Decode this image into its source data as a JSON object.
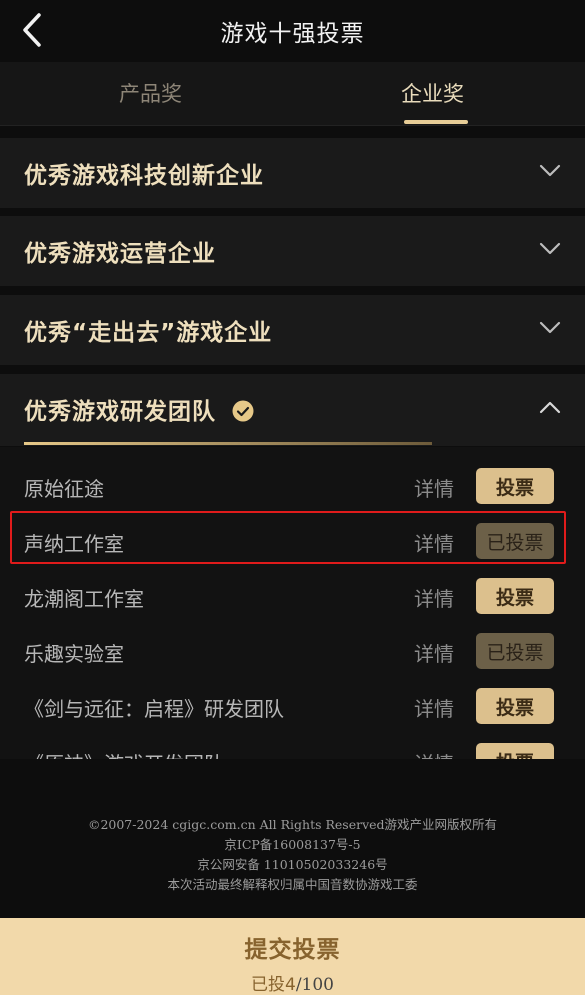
{
  "header": {
    "title": "游戏十强投票"
  },
  "tabs": [
    {
      "label": "产品奖",
      "active": false
    },
    {
      "label": "企业奖",
      "active": true
    }
  ],
  "sections": [
    {
      "title": "优秀游戏科技创新企业",
      "expanded": false
    },
    {
      "title": "优秀游戏运营企业",
      "expanded": false
    },
    {
      "title": "优秀“走出去”游戏企业",
      "expanded": false
    },
    {
      "title": "优秀游戏研发团队",
      "expanded": true,
      "completed": true
    }
  ],
  "list": [
    {
      "name": "原始征途",
      "detail": "详情",
      "vote": "投票",
      "voted": false
    },
    {
      "name": "声纳工作室",
      "detail": "详情",
      "vote": "已投票",
      "voted": true
    },
    {
      "name": "龙潮阁工作室",
      "detail": "详情",
      "vote": "投票",
      "voted": false
    },
    {
      "name": "乐趣实验室",
      "detail": "详情",
      "vote": "已投票",
      "voted": true
    },
    {
      "name": "《剑与远征：启程》研发团队",
      "detail": "详情",
      "vote": "投票",
      "voted": false
    },
    {
      "name": "《原神》游戏开发团队",
      "detail": "详情",
      "vote": "投票",
      "voted": false
    }
  ],
  "footer": {
    "line1": "©2007-2024 cgigc.com.cn All Rights Reserved游戏产业网版权所有",
    "line2": "京ICP备16008137号-5",
    "line3": "京公网安备 11010502033246号",
    "line4": "本次活动最终解释权归属中国音数协游戏工委"
  },
  "submit": {
    "label": "提交投票",
    "count_prefix": "已投",
    "count": "4",
    "total": "/100"
  },
  "colors": {
    "accent_gold": "#e7cd97",
    "vote_button": "#dcc08d",
    "voted_button": "#6c6048",
    "highlight_red": "#e01b1b",
    "submit_bar": "#f2d9aa"
  },
  "icons": {
    "back": "chevron-left-icon",
    "collapsed": "chevron-down-icon",
    "expanded": "chevron-up-icon",
    "completed": "check-circle-icon"
  }
}
